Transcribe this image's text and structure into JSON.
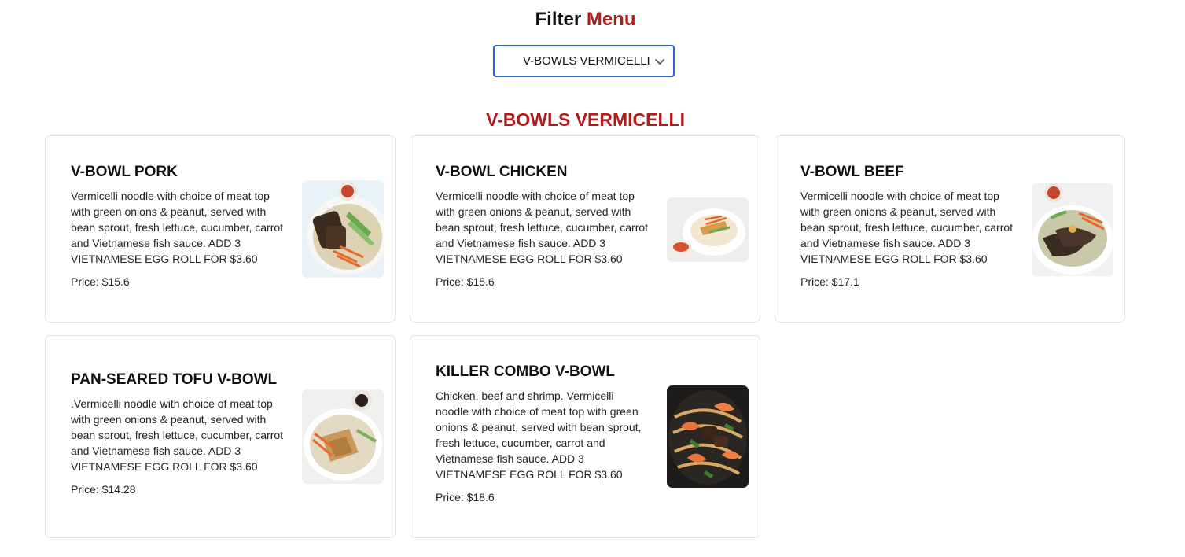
{
  "header": {
    "title_prefix": "Filter",
    "title_accent": "Menu"
  },
  "filter": {
    "selected": "V-BOWLS VERMICELLI",
    "chevron_icon": "chevron-down-icon"
  },
  "category": {
    "title": "V-BOWLS VERMICELLI"
  },
  "colors": {
    "accent": "#b01c1c",
    "select_border": "#2f63c9",
    "card_border": "#e2e2e2"
  },
  "items": [
    {
      "name": "V-BOWL PORK",
      "description": "Vermicelli noodle with choice of meat top with green onions & peanut, served with bean sprout, fresh lettuce, cucumber, carrot and Vietnamese fish sauce. ADD 3 VIETNAMESE EGG ROLL FOR $3.60",
      "price": "Price: $15.6",
      "image_icon": "pork-bowl-photo"
    },
    {
      "name": "V-BOWL CHICKEN",
      "description": "Vermicelli noodle with choice of meat top with green onions & peanut, served with bean sprout, fresh lettuce, cucumber, carrot and Vietnamese fish sauce. ADD 3 VIETNAMESE EGG ROLL FOR $3.60",
      "price": "Price: $15.6",
      "image_icon": "chicken-bowl-photo"
    },
    {
      "name": "V-BOWL BEEF",
      "description": "Vermicelli noodle with choice of meat top with green onions & peanut, served with bean sprout, fresh lettuce, cucumber, carrot and Vietnamese fish sauce. ADD 3 VIETNAMESE EGG ROLL FOR $3.60",
      "price": "Price: $17.1",
      "image_icon": "beef-bowl-photo"
    },
    {
      "name": "PAN-SEARED TOFU V-BOWL",
      "description": ".Vermicelli noodle with choice of meat top with green onions & peanut, served with bean sprout, fresh lettuce, cucumber, carrot and Vietnamese fish sauce. ADD 3 VIETNAMESE EGG ROLL FOR $3.60",
      "price": "Price: $14.28",
      "image_icon": "tofu-bowl-photo"
    },
    {
      "name": "KILLER COMBO V-BOWL",
      "description": "Chicken, beef and shrimp. Vermicelli noodle with choice of meat top with green onions & peanut, served with bean sprout, fresh lettuce, cucumber, carrot and Vietnamese fish sauce. ADD 3 VIETNAMESE EGG ROLL FOR $3.60",
      "price": "Price: $18.6",
      "image_icon": "combo-bowl-photo"
    }
  ]
}
